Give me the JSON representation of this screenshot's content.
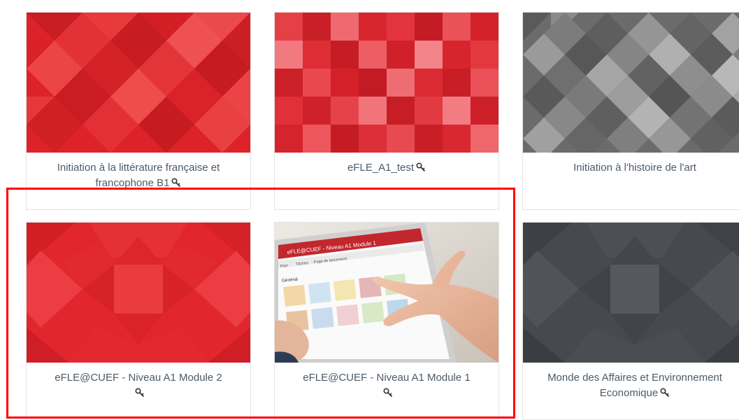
{
  "courses": [
    {
      "title": "Initiation à la littérature française et francophone B1",
      "locked": true,
      "thumb": "red-diamond-pattern"
    },
    {
      "title": "eFLE_A1_test",
      "locked": true,
      "thumb": "red-mosaic-pattern"
    },
    {
      "title": "Initiation à l'histoire de l'art",
      "locked": false,
      "thumb": "gray-diamond-pattern"
    },
    {
      "title": "eFLE@CUEF - Niveau A1 Module 2",
      "locked": true,
      "thumb": "red-geometric-pattern"
    },
    {
      "title": "eFLE@CUEF - Niveau A1 Module 1",
      "locked": true,
      "thumb": "tablet-photo"
    },
    {
      "title": "Monde des Affaires et Environnement Economique",
      "locked": true,
      "thumb": "dark-gray-geometric-pattern"
    }
  ],
  "tablet": {
    "header": "eFLE@CUEF - Niveau A1 Module 1",
    "section": "Général",
    "nav": [
      "Plan",
      "Tâches",
      "Page de lancement"
    ]
  },
  "colors": {
    "highlight": "#ff0000",
    "caption_text": "#4b5a68",
    "card_border": "#e3e3e3",
    "red_pattern": "#e0242c",
    "gray_pattern": "#6f6f6f",
    "dark_gray_pattern": "#45484b"
  },
  "icons": {
    "locked": "key-icon"
  }
}
